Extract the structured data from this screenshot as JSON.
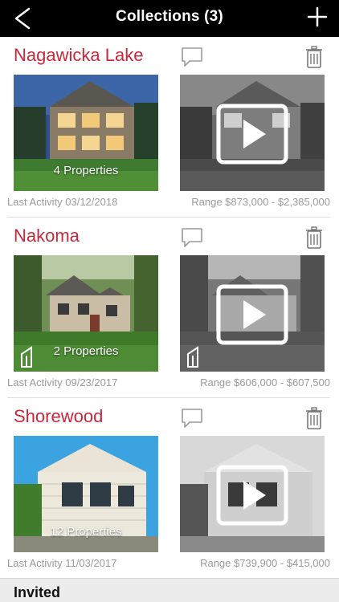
{
  "header": {
    "title": "Collections (3)",
    "back_icon": "chevron-left-icon",
    "add_icon": "plus-icon"
  },
  "collections": [
    {
      "name": "Nagawicka Lake",
      "count_label": "4 Properties",
      "last_activity": "Last Activity 03/12/2018",
      "range": "Range $873,000 - $2,385,000"
    },
    {
      "name": "Nakoma",
      "count_label": "2 Properties",
      "last_activity": "Last Activity 09/23/2017",
      "range": "Range $606,000 - $607,500"
    },
    {
      "name": "Shorewood",
      "count_label": "12 Properties",
      "last_activity": "Last Activity 11/03/2017",
      "range": "Range $739,900 - $415,000"
    }
  ],
  "section": {
    "invited_label": "Invited"
  },
  "colors": {
    "header_bg": "#000000",
    "collection_name": "#c8283a",
    "meta_text": "#9a9a9a"
  }
}
